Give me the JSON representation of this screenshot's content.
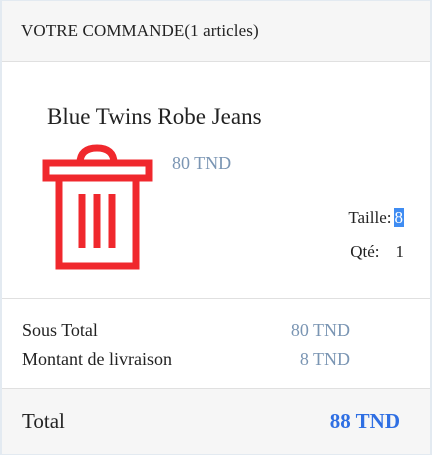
{
  "order": {
    "header_title": "VOTRE COMMANDE(1 articles)"
  },
  "item": {
    "name": "Blue Twins Robe Jeans",
    "price": "80 TND",
    "size_label": "Taille:",
    "size_value": "8",
    "qty_label": "Qté:",
    "qty_value": "1",
    "delete_icon": "trash-icon",
    "delete_icon_color": "#f0282d"
  },
  "summary": {
    "subtotal_label": "Sous Total",
    "subtotal_value": "80 TND",
    "shipping_label": "Montant de livraison",
    "shipping_value": "8 TND"
  },
  "total": {
    "label": "Total",
    "value": "88 TND",
    "color": "#2f6fe3"
  }
}
